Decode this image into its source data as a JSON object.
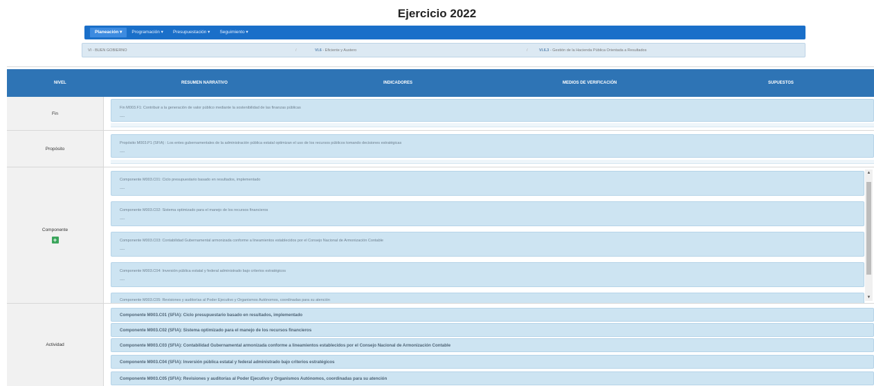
{
  "page": {
    "title": "Ejercicio 2022"
  },
  "nav": {
    "items": [
      {
        "label": "Planeación",
        "active": true
      },
      {
        "label": "Programación",
        "active": false
      },
      {
        "label": "Presupuestación",
        "active": false
      },
      {
        "label": "Seguimiento",
        "active": false
      }
    ]
  },
  "breadcrumb": {
    "item1": "VI - BUEN GOBIERNO",
    "item2_code": "VI.6",
    "item2_text": " - Eficiente y Austero",
    "item3_code": "VI.6.3",
    "item3_text": " - Gestión de la Hacienda Pública Orientada a Resultados",
    "separator": "/"
  },
  "table_header": {
    "nivel": "NIVEL",
    "resumen": "RESUMEN NARRATIVO",
    "indicadores": "INDICADORES",
    "medios": "MEDIOS DE VERIFICACIÓN",
    "supuestos": "SUPUESTOS"
  },
  "levels": {
    "fin": "Fin",
    "proposito": "Propósito",
    "componente": "Componente",
    "actividad": "Actividad"
  },
  "fin": {
    "text": "Fin M003.F1: Contribuir a la generación de valor público mediante la sostenibilidad de las finanzas públicas",
    "dash": "----"
  },
  "proposito": {
    "text": "Propósito M003.P1 (SFIA) : Los entes gubernamentales de la administración pública estatal optimizan el uso de los recursos públicos tomando decisiones estratégicas",
    "dash": "----"
  },
  "componentes": [
    {
      "text": "Componente M003.C01: Ciclo presupuestario basado en resultados, implementado",
      "dash": "----"
    },
    {
      "text": "Componente M003.C02: Sistema optimizado para el manejo de los recursos financieros",
      "dash": "----"
    },
    {
      "text": "Componente M003.C03: Contabilidad Gubernamental armonizada conforme a lineamientos establecidos por el Consejo Nacional de Armonización Contable",
      "dash": "----"
    },
    {
      "text": "Componente M003.C04: Inversión pública estatal y federal administrado bajo criterios estratégicos",
      "dash": "----"
    },
    {
      "text": "Componente M003.C05: Revisiones y auditorías al Poder Ejecutivo y Organismos Autónomos, coordinadas para su atención",
      "dash": ""
    }
  ],
  "add_button": "+",
  "actividades": [
    "Componente M003.C01 (SFIA): Ciclo presupuestario basado en resultados, implementado",
    "Componente M003.C02 (SFIA): Sistema optimizado para el manejo de los recursos financieros",
    "Componente M003.C03 (SFIA): Contabilidad Gubernamental armonizada conforme a lineamientos establecidos por el Consejo Nacional de Armonización Contable",
    "Componente M003.C04 (SFIA): Inversión pública estatal y federal administrado bajo criterios estratégicos",
    "Componente M003.C05 (SFIA): Revisiones y auditorías al Poder Ejecutivo y Organismos Autónomos, coordinadas para su atención"
  ],
  "scrollbar": {
    "up": "▲",
    "down": "▼"
  },
  "colors": {
    "header_bg": "#2e74b5",
    "navbar_bg": "#1a6fc9",
    "panel_bg": "#cde4f2",
    "add_button": "#3ba55c"
  }
}
